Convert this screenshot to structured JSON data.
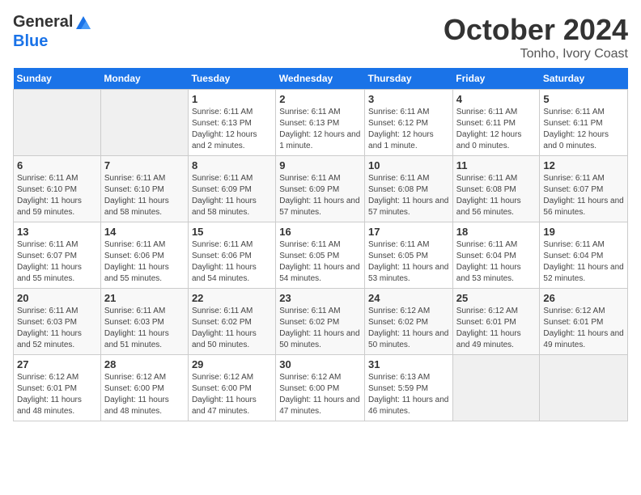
{
  "logo": {
    "general": "General",
    "blue": "Blue"
  },
  "header": {
    "month": "October 2024",
    "location": "Tonho, Ivory Coast"
  },
  "days_of_week": [
    "Sunday",
    "Monday",
    "Tuesday",
    "Wednesday",
    "Thursday",
    "Friday",
    "Saturday"
  ],
  "weeks": [
    [
      {
        "day": "",
        "sunrise": "",
        "sunset": "",
        "daylight": ""
      },
      {
        "day": "",
        "sunrise": "",
        "sunset": "",
        "daylight": ""
      },
      {
        "day": "1",
        "sunrise": "Sunrise: 6:11 AM",
        "sunset": "Sunset: 6:13 PM",
        "daylight": "Daylight: 12 hours and 2 minutes."
      },
      {
        "day": "2",
        "sunrise": "Sunrise: 6:11 AM",
        "sunset": "Sunset: 6:13 PM",
        "daylight": "Daylight: 12 hours and 1 minute."
      },
      {
        "day": "3",
        "sunrise": "Sunrise: 6:11 AM",
        "sunset": "Sunset: 6:12 PM",
        "daylight": "Daylight: 12 hours and 1 minute."
      },
      {
        "day": "4",
        "sunrise": "Sunrise: 6:11 AM",
        "sunset": "Sunset: 6:11 PM",
        "daylight": "Daylight: 12 hours and 0 minutes."
      },
      {
        "day": "5",
        "sunrise": "Sunrise: 6:11 AM",
        "sunset": "Sunset: 6:11 PM",
        "daylight": "Daylight: 12 hours and 0 minutes."
      }
    ],
    [
      {
        "day": "6",
        "sunrise": "Sunrise: 6:11 AM",
        "sunset": "Sunset: 6:10 PM",
        "daylight": "Daylight: 11 hours and 59 minutes."
      },
      {
        "day": "7",
        "sunrise": "Sunrise: 6:11 AM",
        "sunset": "Sunset: 6:10 PM",
        "daylight": "Daylight: 11 hours and 58 minutes."
      },
      {
        "day": "8",
        "sunrise": "Sunrise: 6:11 AM",
        "sunset": "Sunset: 6:09 PM",
        "daylight": "Daylight: 11 hours and 58 minutes."
      },
      {
        "day": "9",
        "sunrise": "Sunrise: 6:11 AM",
        "sunset": "Sunset: 6:09 PM",
        "daylight": "Daylight: 11 hours and 57 minutes."
      },
      {
        "day": "10",
        "sunrise": "Sunrise: 6:11 AM",
        "sunset": "Sunset: 6:08 PM",
        "daylight": "Daylight: 11 hours and 57 minutes."
      },
      {
        "day": "11",
        "sunrise": "Sunrise: 6:11 AM",
        "sunset": "Sunset: 6:08 PM",
        "daylight": "Daylight: 11 hours and 56 minutes."
      },
      {
        "day": "12",
        "sunrise": "Sunrise: 6:11 AM",
        "sunset": "Sunset: 6:07 PM",
        "daylight": "Daylight: 11 hours and 56 minutes."
      }
    ],
    [
      {
        "day": "13",
        "sunrise": "Sunrise: 6:11 AM",
        "sunset": "Sunset: 6:07 PM",
        "daylight": "Daylight: 11 hours and 55 minutes."
      },
      {
        "day": "14",
        "sunrise": "Sunrise: 6:11 AM",
        "sunset": "Sunset: 6:06 PM",
        "daylight": "Daylight: 11 hours and 55 minutes."
      },
      {
        "day": "15",
        "sunrise": "Sunrise: 6:11 AM",
        "sunset": "Sunset: 6:06 PM",
        "daylight": "Daylight: 11 hours and 54 minutes."
      },
      {
        "day": "16",
        "sunrise": "Sunrise: 6:11 AM",
        "sunset": "Sunset: 6:05 PM",
        "daylight": "Daylight: 11 hours and 54 minutes."
      },
      {
        "day": "17",
        "sunrise": "Sunrise: 6:11 AM",
        "sunset": "Sunset: 6:05 PM",
        "daylight": "Daylight: 11 hours and 53 minutes."
      },
      {
        "day": "18",
        "sunrise": "Sunrise: 6:11 AM",
        "sunset": "Sunset: 6:04 PM",
        "daylight": "Daylight: 11 hours and 53 minutes."
      },
      {
        "day": "19",
        "sunrise": "Sunrise: 6:11 AM",
        "sunset": "Sunset: 6:04 PM",
        "daylight": "Daylight: 11 hours and 52 minutes."
      }
    ],
    [
      {
        "day": "20",
        "sunrise": "Sunrise: 6:11 AM",
        "sunset": "Sunset: 6:03 PM",
        "daylight": "Daylight: 11 hours and 52 minutes."
      },
      {
        "day": "21",
        "sunrise": "Sunrise: 6:11 AM",
        "sunset": "Sunset: 6:03 PM",
        "daylight": "Daylight: 11 hours and 51 minutes."
      },
      {
        "day": "22",
        "sunrise": "Sunrise: 6:11 AM",
        "sunset": "Sunset: 6:02 PM",
        "daylight": "Daylight: 11 hours and 50 minutes."
      },
      {
        "day": "23",
        "sunrise": "Sunrise: 6:11 AM",
        "sunset": "Sunset: 6:02 PM",
        "daylight": "Daylight: 11 hours and 50 minutes."
      },
      {
        "day": "24",
        "sunrise": "Sunrise: 6:12 AM",
        "sunset": "Sunset: 6:02 PM",
        "daylight": "Daylight: 11 hours and 50 minutes."
      },
      {
        "day": "25",
        "sunrise": "Sunrise: 6:12 AM",
        "sunset": "Sunset: 6:01 PM",
        "daylight": "Daylight: 11 hours and 49 minutes."
      },
      {
        "day": "26",
        "sunrise": "Sunrise: 6:12 AM",
        "sunset": "Sunset: 6:01 PM",
        "daylight": "Daylight: 11 hours and 49 minutes."
      }
    ],
    [
      {
        "day": "27",
        "sunrise": "Sunrise: 6:12 AM",
        "sunset": "Sunset: 6:01 PM",
        "daylight": "Daylight: 11 hours and 48 minutes."
      },
      {
        "day": "28",
        "sunrise": "Sunrise: 6:12 AM",
        "sunset": "Sunset: 6:00 PM",
        "daylight": "Daylight: 11 hours and 48 minutes."
      },
      {
        "day": "29",
        "sunrise": "Sunrise: 6:12 AM",
        "sunset": "Sunset: 6:00 PM",
        "daylight": "Daylight: 11 hours and 47 minutes."
      },
      {
        "day": "30",
        "sunrise": "Sunrise: 6:12 AM",
        "sunset": "Sunset: 6:00 PM",
        "daylight": "Daylight: 11 hours and 47 minutes."
      },
      {
        "day": "31",
        "sunrise": "Sunrise: 6:13 AM",
        "sunset": "Sunset: 5:59 PM",
        "daylight": "Daylight: 11 hours and 46 minutes."
      },
      {
        "day": "",
        "sunrise": "",
        "sunset": "",
        "daylight": ""
      },
      {
        "day": "",
        "sunrise": "",
        "sunset": "",
        "daylight": ""
      }
    ]
  ]
}
